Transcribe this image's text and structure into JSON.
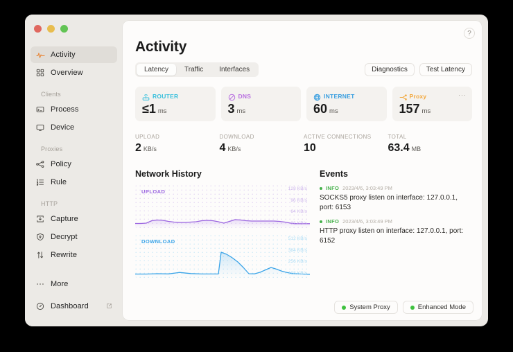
{
  "window": {
    "traffic_lights": [
      "close",
      "minimize",
      "zoom"
    ]
  },
  "sidebar": {
    "items": [
      {
        "label": "Activity",
        "icon": "activity-pulse-icon",
        "active": true
      },
      {
        "label": "Overview",
        "icon": "grid-icon",
        "active": false
      }
    ],
    "sections": [
      {
        "title": "Clients",
        "items": [
          {
            "label": "Process",
            "icon": "process-window-icon"
          },
          {
            "label": "Device",
            "icon": "monitor-icon"
          }
        ]
      },
      {
        "title": "Proxies",
        "items": [
          {
            "label": "Policy",
            "icon": "share-nodes-icon"
          },
          {
            "label": "Rule",
            "icon": "list-ordered-icon"
          }
        ]
      },
      {
        "title": "HTTP",
        "items": [
          {
            "label": "Capture",
            "icon": "capture-download-icon"
          },
          {
            "label": "Decrypt",
            "icon": "shield-lock-icon"
          },
          {
            "label": "Rewrite",
            "icon": "arrows-rewrite-icon"
          }
        ]
      }
    ],
    "more": {
      "label": "More",
      "icon": "ellipsis-icon"
    },
    "dashboard": {
      "label": "Dashboard",
      "icon": "dashboard-gauge-icon",
      "external_icon": "external-link-icon"
    }
  },
  "header": {
    "title": "Activity",
    "help_label": "?",
    "tabs": [
      {
        "label": "Latency",
        "active": true
      },
      {
        "label": "Traffic",
        "active": false
      },
      {
        "label": "Interfaces",
        "active": false
      }
    ],
    "actions": [
      {
        "label": "Diagnostics"
      },
      {
        "label": "Test Latency"
      }
    ]
  },
  "cards": [
    {
      "name": "ROUTER",
      "icon": "router-icon",
      "color": "#39c0dd",
      "value": "≤1",
      "unit": "ms",
      "menu": ""
    },
    {
      "name": "DNS",
      "icon": "dns-icon",
      "color": "#b86fe0",
      "value": "3",
      "unit": "ms",
      "menu": ""
    },
    {
      "name": "INTERNET",
      "icon": "globe-icon",
      "color": "#3a9fe0",
      "value": "60",
      "unit": "ms",
      "menu": ""
    },
    {
      "name": "Proxy",
      "icon": "proxy-icon",
      "color": "#f2a73b",
      "value": "157",
      "unit": "ms",
      "menu": "···"
    }
  ],
  "stats": [
    {
      "label": "UPLOAD",
      "value": "2",
      "unit": "KB/s"
    },
    {
      "label": "DOWNLOAD",
      "value": "4",
      "unit": "KB/s"
    },
    {
      "label": "ACTIVE CONNECTIONS",
      "value": "10",
      "unit": ""
    },
    {
      "label": "TOTAL",
      "value": "63.4",
      "unit": "MB"
    }
  ],
  "network_history": {
    "title": "Network History",
    "graphs": [
      {
        "tag": "UPLOAD",
        "color": "#9a64e0",
        "ticks": [
          "128 KB/s",
          "96 KB/s",
          "64 KB/s",
          "32 KB/s"
        ]
      },
      {
        "tag": "DOWNLOAD",
        "color": "#3aa4e8",
        "ticks": [
          "512 KB/s",
          "384 KB/s",
          "256 KB/s",
          "128 KB/s"
        ]
      }
    ]
  },
  "chart_data": [
    {
      "type": "area",
      "title": "Network History — Upload",
      "ylabel": "KB/s",
      "ylim": [
        0,
        160
      ],
      "yticks": [
        128,
        96,
        64,
        32
      ],
      "grid": true,
      "series": [
        {
          "name": "UPLOAD",
          "color": "#9a64e0",
          "values": [
            4,
            4,
            5,
            10,
            12,
            11,
            9,
            7,
            6,
            6,
            7,
            8,
            10,
            11,
            10,
            8,
            5,
            9,
            13,
            12,
            10,
            9,
            9,
            9,
            9,
            9,
            9,
            8,
            7,
            5,
            4,
            4
          ]
        }
      ]
    },
    {
      "type": "area",
      "title": "Network History — Download",
      "ylabel": "KB/s",
      "ylim": [
        0,
        640
      ],
      "yticks": [
        512,
        384,
        256,
        128
      ],
      "grid": true,
      "series": [
        {
          "name": "DOWNLOAD",
          "color": "#3aa4e8",
          "values": [
            12,
            12,
            14,
            13,
            14,
            30,
            22,
            14,
            13,
            13,
            13,
            13,
            13,
            13,
            260,
            230,
            190,
            150,
            100,
            20,
            18,
            25,
            40,
            70,
            95,
            80,
            55,
            35,
            22,
            16,
            13,
            12
          ]
        }
      ]
    }
  ],
  "events": {
    "title": "Events",
    "items": [
      {
        "level": "INFO",
        "time": "2023/4/6, 3:03:49 PM",
        "message": "SOCKS5 proxy listen on interface: 127.0.0.1, port: 6153"
      },
      {
        "level": "INFO",
        "time": "2023/4/6, 3:03:49 PM",
        "message": "HTTP proxy listen on interface: 127.0.0.1, port: 6152"
      }
    ]
  },
  "footer": {
    "statuses": [
      {
        "label": "System Proxy",
        "color": "#3ec13e"
      },
      {
        "label": "Enhanced Mode",
        "color": "#3ec13e"
      }
    ]
  }
}
